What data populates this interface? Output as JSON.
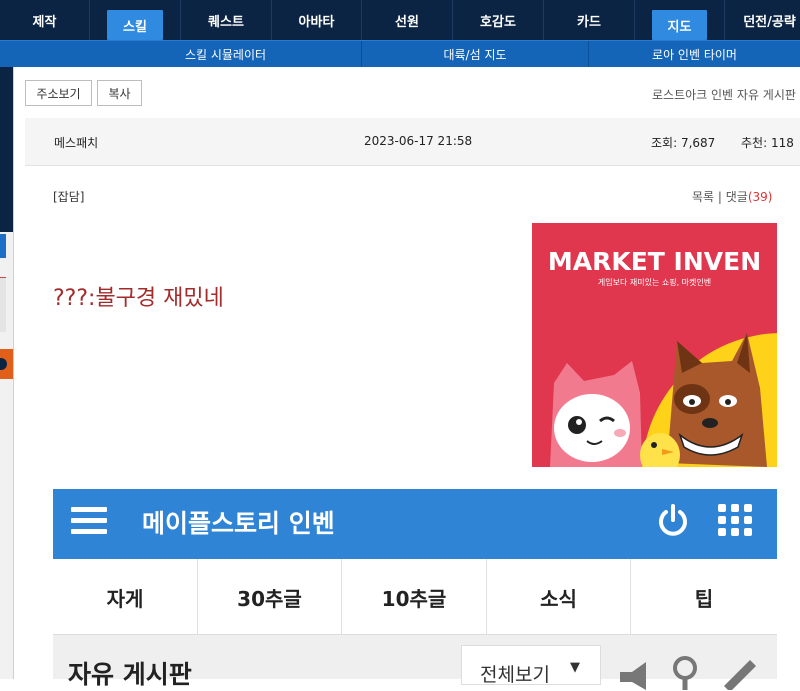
{
  "topnav": {
    "tabs": [
      {
        "label": "제작",
        "active": false
      },
      {
        "label": "스킬",
        "active": true
      },
      {
        "label": "퀘스트",
        "active": false
      },
      {
        "label": "아바타",
        "active": false
      },
      {
        "label": "선원",
        "active": false
      },
      {
        "label": "호감도",
        "active": false
      },
      {
        "label": "카드",
        "active": false
      },
      {
        "label": "지도",
        "active": true
      },
      {
        "label": "던전/공략",
        "active": false
      }
    ]
  },
  "subnav": {
    "items": [
      "스킬 시뮬레이터",
      "대륙/섬 지도",
      "로아 인벤 타이머"
    ]
  },
  "actions": {
    "short_url": "주소보기",
    "copy": "복사"
  },
  "board_link": "로스트아크 인벤 자유 게시판",
  "post": {
    "author": "메스패치",
    "datetime": "2023-06-17 21:58",
    "views_label": "조회:",
    "views": "7,687",
    "recommend_label": "추천:",
    "recommend": "118",
    "category": "[잡담]",
    "list_label": "목록",
    "comments_label": "댓글",
    "comments_count": "(39)",
    "body": "???:불구경 재밌네"
  },
  "ad": {
    "logo": "MARKET INVEN",
    "tagline": "게임보다 재미있는 쇼핑, 마켓인벤"
  },
  "mobile": {
    "title": "메이플스토리 인벤",
    "tabs": [
      "자게",
      "30추글",
      "10추글",
      "소식",
      "팁"
    ],
    "board_title": "자유 게시판",
    "filter": "전체보기"
  },
  "colors": {
    "nav_dark": "#0c2444",
    "nav_active": "#2f8ae0",
    "subnav": "#1465b8",
    "mobile_header": "#2f84d6",
    "post_text": "#a32b2b",
    "ad_bg": "#e0374f"
  }
}
